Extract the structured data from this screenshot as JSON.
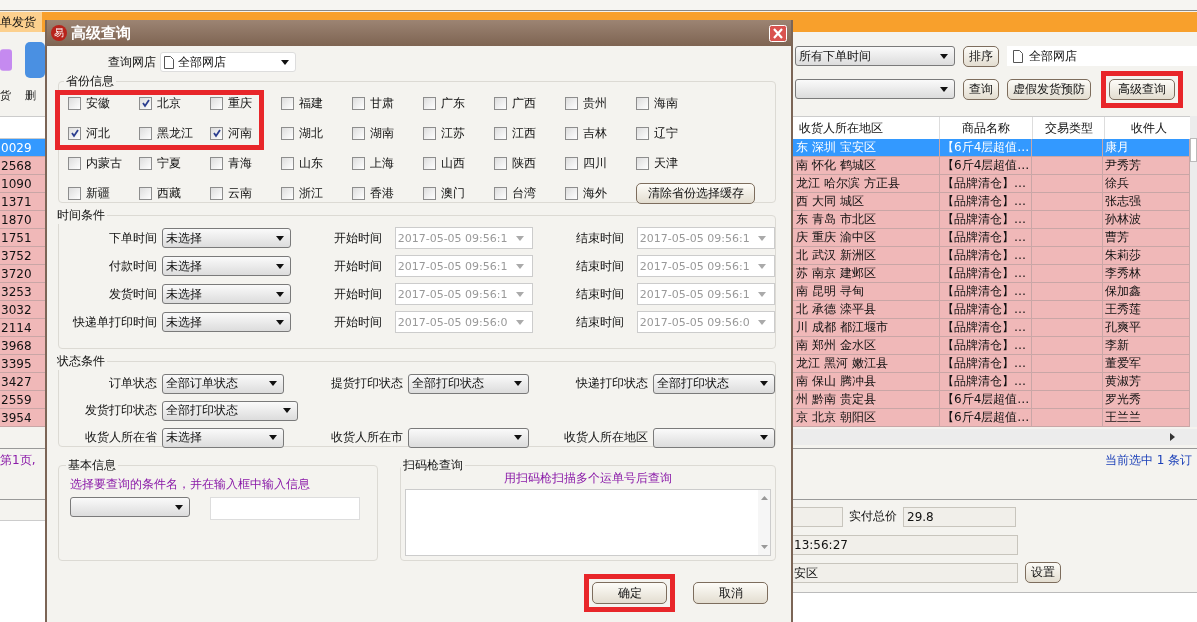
{
  "app": {
    "tabs": [
      {
        "label": "单发货",
        "selected": true
      }
    ],
    "tools": [
      {
        "label": "货",
        "color": "#c58af0"
      },
      {
        "label": "删",
        "color": "#4a90e2"
      }
    ],
    "time_filter": "所有下单时间",
    "store_filter": "全部网店",
    "sort_button": "排序",
    "buttons": [
      {
        "label": "查询",
        "highlighted": false
      },
      {
        "label": "虚假发货预防",
        "highlighted": false
      },
      {
        "label": "高级查询",
        "highlighted": true
      }
    ],
    "table": {
      "columns": [
        "收货人所在地区",
        "商品名称",
        "交易类型",
        "收件人"
      ],
      "rows": [
        {
          "column_1": "0029",
          "region": "东 深圳 宝安区",
          "product": "【6斤4层超值…",
          "receiver": "康月",
          "selected": true
        },
        {
          "column_1": "2568",
          "region": "南 怀化 鹤城区",
          "product": "【6斤4层超值…",
          "receiver": "尹秀芳",
          "selected": false
        },
        {
          "column_1": "1090",
          "region": "龙江 哈尔滨 方正县",
          "product": "【品牌清仓】…",
          "receiver": "徐兵",
          "selected": false
        },
        {
          "column_1": "1371",
          "region": "西 大同 城区",
          "product": "【品牌清仓】…",
          "receiver": "张志强",
          "selected": false
        },
        {
          "column_1": "1870",
          "region": "东 青岛 市北区",
          "product": "【品牌清仓】…",
          "receiver": "孙林波",
          "selected": false
        },
        {
          "column_1": "1751",
          "region": "庆 重庆 渝中区",
          "product": "【品牌清仓】…",
          "receiver": "曹芳",
          "selected": false
        },
        {
          "column_1": "3752",
          "region": "北 武汉 新洲区",
          "product": "【品牌清仓】…",
          "receiver": "朱莉莎",
          "selected": false
        },
        {
          "column_1": "3720",
          "region": "苏 南京 建邺区",
          "product": "【品牌清仓】…",
          "receiver": "李秀林",
          "selected": false
        },
        {
          "column_1": "3253",
          "region": "南 昆明 寻甸",
          "product": "【品牌清仓】…",
          "receiver": "保加鑫",
          "selected": false
        },
        {
          "column_1": "3032",
          "region": "北 承德 滦平县",
          "product": "【品牌清仓】…",
          "receiver": "王秀莲",
          "selected": false
        },
        {
          "column_1": "2114",
          "region": "川 成都 都江堰市",
          "product": "【品牌清仓】…",
          "receiver": "孔爽平",
          "selected": false
        },
        {
          "column_1": "3968",
          "region": "南 郑州 金水区",
          "product": "【品牌清仓】…",
          "receiver": "李新",
          "selected": false
        },
        {
          "column_1": "3395",
          "region": "龙江 黑河 嫩江县",
          "product": "【品牌清仓】…",
          "receiver": "董爱军",
          "selected": false
        },
        {
          "column_1": "3427",
          "region": "南 保山 腾冲县",
          "product": "【品牌清仓】…",
          "receiver": "黄淑芳",
          "selected": false
        },
        {
          "column_1": "2559",
          "region": "州 黔南 贵定县",
          "product": "【6斤4层超值…",
          "receiver": "罗光秀",
          "selected": false
        },
        {
          "column_1": "3954",
          "region": "京 北京 朝阳区",
          "product": "【6斤4层超值…",
          "receiver": "王兰兰",
          "selected": false
        }
      ]
    },
    "status": {
      "page": "第1页,",
      "selection": "当前选中 1 条订"
    },
    "details": {
      "total_label": "实付总价",
      "total": "29.8",
      "time": "13:56:27",
      "area": "安区",
      "set_button": "设置"
    }
  },
  "dialog": {
    "icon_glyph": "易",
    "title": "高级查询",
    "store": {
      "label": "查询网店",
      "value": "全部网店"
    },
    "provinces": {
      "title": "省份信息",
      "highlight_box": true,
      "clear_button": "清除省份选择缓存",
      "items": [
        {
          "label": "安徽",
          "checked": false
        },
        {
          "label": "北京",
          "checked": true
        },
        {
          "label": "重庆",
          "checked": false
        },
        {
          "label": "福建",
          "checked": false
        },
        {
          "label": "甘肃",
          "checked": false
        },
        {
          "label": "广东",
          "checked": false
        },
        {
          "label": "广西",
          "checked": false
        },
        {
          "label": "贵州",
          "checked": false
        },
        {
          "label": "海南",
          "checked": false
        },
        {
          "label": "河北",
          "checked": true
        },
        {
          "label": "黑龙江",
          "checked": false
        },
        {
          "label": "河南",
          "checked": true
        },
        {
          "label": "湖北",
          "checked": false
        },
        {
          "label": "湖南",
          "checked": false
        },
        {
          "label": "江苏",
          "checked": false
        },
        {
          "label": "江西",
          "checked": false
        },
        {
          "label": "吉林",
          "checked": false
        },
        {
          "label": "辽宁",
          "checked": false
        },
        {
          "label": "内蒙古",
          "checked": false
        },
        {
          "label": "宁夏",
          "checked": false
        },
        {
          "label": "青海",
          "checked": false
        },
        {
          "label": "山东",
          "checked": false
        },
        {
          "label": "上海",
          "checked": false
        },
        {
          "label": "山西",
          "checked": false
        },
        {
          "label": "陕西",
          "checked": false
        },
        {
          "label": "四川",
          "checked": false
        },
        {
          "label": "天津",
          "checked": false
        },
        {
          "label": "新疆",
          "checked": false
        },
        {
          "label": "西藏",
          "checked": false
        },
        {
          "label": "云南",
          "checked": false
        },
        {
          "label": "浙江",
          "checked": false
        },
        {
          "label": "香港",
          "checked": false
        },
        {
          "label": "澳门",
          "checked": false
        },
        {
          "label": "台湾",
          "checked": false
        },
        {
          "label": "海外",
          "checked": false
        }
      ]
    },
    "time": {
      "title": "时间条件",
      "rows": [
        {
          "label": "下单时间",
          "value": "未选择",
          "start_label": "开始时间",
          "start": "2017-05-05 09:56:1",
          "end_label": "结束时间",
          "end": "2017-05-05 09:56:1",
          "disabled": true
        },
        {
          "label": "付款时间",
          "value": "未选择",
          "start_label": "开始时间",
          "start": "2017-05-05 09:56:1",
          "end_label": "结束时间",
          "end": "2017-05-05 09:56:1",
          "disabled": true
        },
        {
          "label": "发货时间",
          "value": "未选择",
          "start_label": "开始时间",
          "start": "2017-05-05 09:56:1",
          "end_label": "结束时间",
          "end": "2017-05-05 09:56:1",
          "disabled": true
        },
        {
          "label": "快递单打印时间",
          "value": "未选择",
          "start_label": "开始时间",
          "start": "2017-05-05 09:56:0",
          "end_label": "结束时间",
          "end": "2017-05-05 09:56:0",
          "disabled": true
        }
      ]
    },
    "state": {
      "title": "状态条件",
      "rows": [
        [
          {
            "label": "订单状态",
            "value": "全部订单状态"
          },
          {
            "label": "提货打印状态",
            "value": "全部打印状态"
          },
          {
            "label": "快递打印状态",
            "value": "全部打印状态"
          }
        ],
        [
          {
            "label": "发货打印状态",
            "value": "全部打印状态"
          }
        ],
        [
          {
            "label": "收货人所在省",
            "value": "未选择"
          },
          {
            "label": "收货人所在市"
          },
          {
            "label": "收货人所在地区"
          }
        ]
      ]
    },
    "basic": {
      "title": "基本信息",
      "hint": "选择要查询的条件名，并在输入框中输入信息"
    },
    "scan": {
      "title": "扫码枪查询",
      "hint": "用扫码枪扫描多个运单号后查询"
    },
    "buttons": [
      {
        "label": "确定",
        "highlighted": true
      },
      {
        "label": "取消",
        "highlighted": false
      }
    ]
  }
}
